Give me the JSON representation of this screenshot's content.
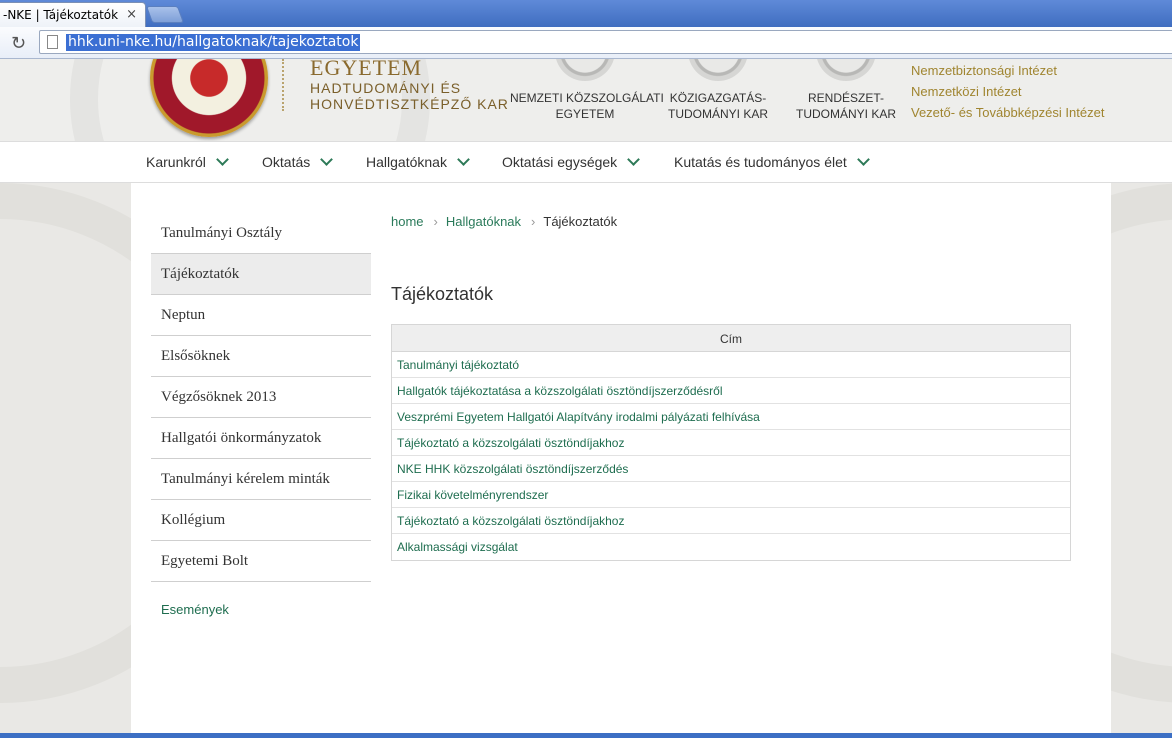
{
  "browser": {
    "tab_title": "-NKE | Tájékoztatók",
    "tab_close": "×",
    "url": "hhk.uni-nke.hu/hallgatoknak/tajekoztatok",
    "reload_icon": "reload-icon"
  },
  "header": {
    "egyetem": "EGYETEM",
    "faculty_line1": "HADTUDOMÁNYI ÉS",
    "faculty_line2": "HONVÉDTISZTKÉPZŐ KAR",
    "partners": [
      {
        "line1": "NEMZETI KÖZSZOLGÁLATI",
        "line2": "EGYETEM"
      },
      {
        "line1": "KÖZIGAZGATÁS-",
        "line2": "TUDOMÁNYI KAR"
      },
      {
        "line1": "RENDÉSZET-",
        "line2": "TUDOMÁNYI KAR"
      }
    ],
    "institutes": [
      "Nemzetbiztonsági Intézet",
      "Nemzetközi Intézet",
      "Vezető- és Továbbképzési Intézet"
    ]
  },
  "mainnav": {
    "items": [
      "Karunkról",
      "Oktatás",
      "Hallgatóknak",
      "Oktatási egységek",
      "Kutatás és tudományos élet"
    ]
  },
  "sidebar": {
    "items": [
      "Tanulmányi Osztály",
      "Tájékoztatók",
      "Neptun",
      "Elsősöknek",
      "Végzősöknek 2013",
      "Hallgatói önkormányzatok",
      "Tanulmányi kérelem minták",
      "Kollégium",
      "Egyetemi Bolt"
    ],
    "active": "Tájékoztatók",
    "events": "Események"
  },
  "breadcrumb": {
    "home": "home",
    "parent": "Hallgatóknak",
    "current": "Tájékoztatók"
  },
  "main": {
    "title": "Tájékoztatók",
    "table_header": "Cím",
    "rows": [
      "Tanulmányi tájékoztató",
      "Hallgatók tájékoztatása a közszolgálati ösztöndíjszerződésről",
      "Veszprémi Egyetem Hallgatói Alapítvány irodalmi pályázati felhívása",
      "Tájékoztató a közszolgálati ösztöndíjakhoz",
      "NKE HHK közszolgálati ösztöndíjszerződés",
      "Fizikai követelményrendszer",
      "Tájékoztató a közszolgálati ösztöndíjakhoz",
      "Alkalmassági vizsgálat"
    ]
  },
  "colors": {
    "accent_green": "#1e6d4f",
    "gold": "#a08530",
    "browser_blue": "#4a79c9"
  }
}
